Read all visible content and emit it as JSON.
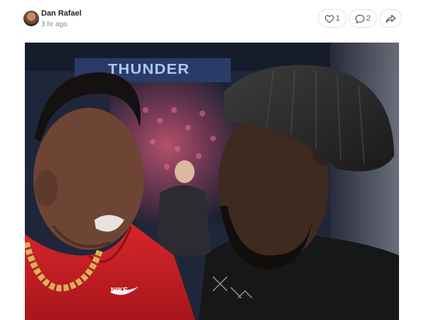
{
  "post": {
    "author": "Dan Rafael",
    "time": "3 hr ago",
    "avatar_icon": "user-avatar"
  },
  "actions": {
    "like_count": "1",
    "comment_count": "2",
    "like_icon": "heart-icon",
    "comment_icon": "comment-bubble-icon",
    "share_icon": "share-arrow-icon"
  },
  "photo": {
    "banner_text": "THUNDER",
    "shirt_logo": "NIKE"
  },
  "colors": {
    "accent_text": "#222222",
    "muted_text": "#888888",
    "pill_border": "#e3e3e3"
  }
}
